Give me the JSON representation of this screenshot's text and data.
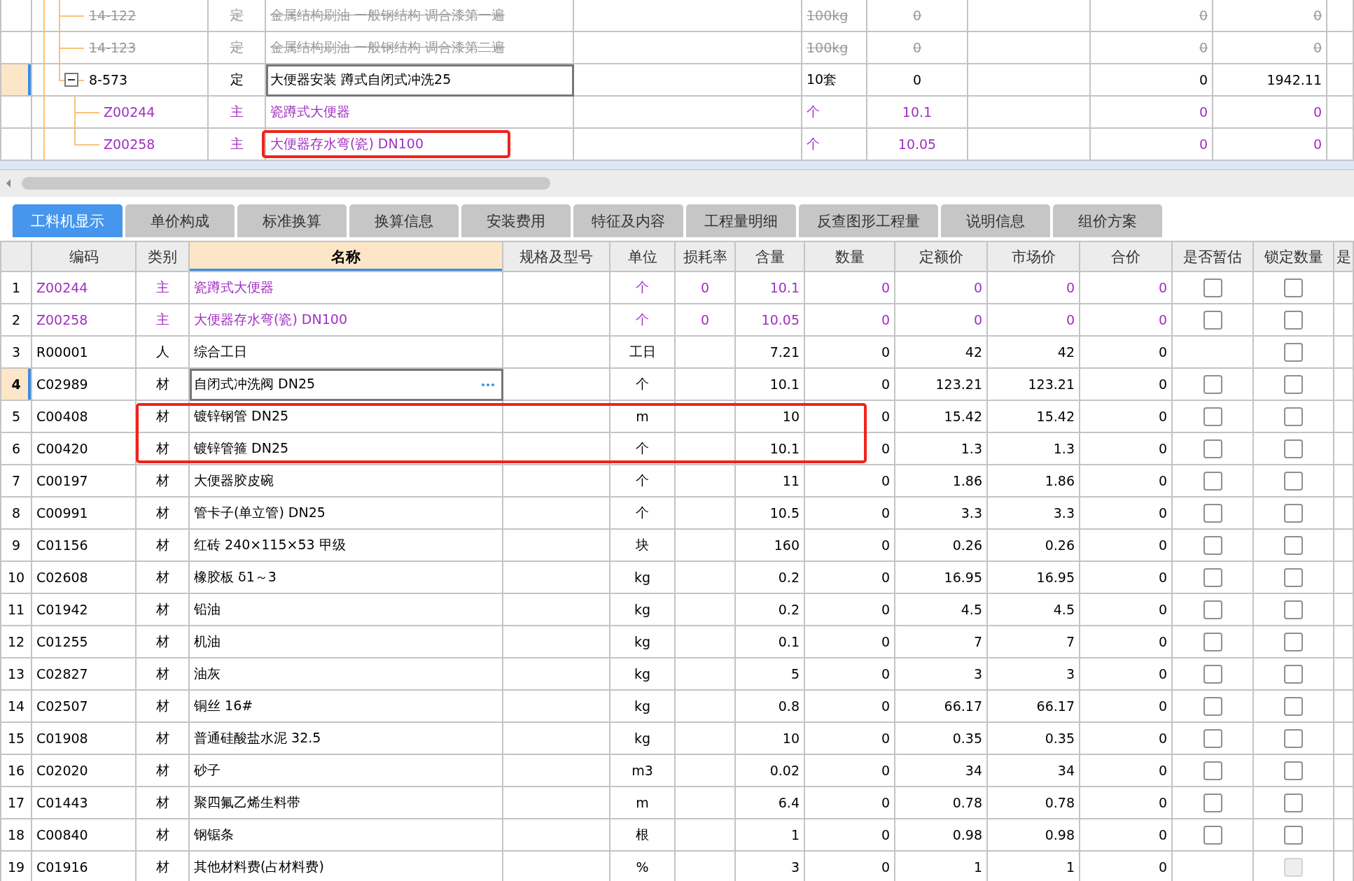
{
  "top": {
    "rows": [
      {
        "code": "14-122",
        "type": "定",
        "name": "金属结构刷油 一般钢结构 调合漆第一遍",
        "unit": "100kg",
        "qty": "0",
        "col_8": "0",
        "col_9": "0",
        "deleted": true,
        "selected": false,
        "color": "#999999"
      },
      {
        "code": "14-123",
        "type": "定",
        "name": "金属结构刷油 一般钢结构 调合漆第二遍",
        "unit": "100kg",
        "qty": "0",
        "col_8": "0",
        "col_9": "0",
        "deleted": true,
        "selected": false,
        "color": "#999999"
      },
      {
        "code": "8-573",
        "type": "定",
        "name": "大便器安装 蹲式自闭式冲洗25",
        "unit": "10套",
        "qty": "0",
        "col_8": "0",
        "col_9": "1942.11",
        "deleted": false,
        "selected": true,
        "expanded": true,
        "color": "#000000",
        "children": [
          {
            "code": "Z00244",
            "type": "主",
            "name": "瓷蹲式大便器",
            "unit": "个",
            "qty": "10.1",
            "col_8": "0",
            "col_9": "0",
            "deleted": false,
            "selected": false,
            "color": "#a030c0"
          },
          {
            "code": "Z00258",
            "type": "主",
            "name": "大便器存水弯(瓷) DN100",
            "unit": "个",
            "qty": "10.05",
            "col_8": "0",
            "col_9": "0",
            "deleted": false,
            "selected": false,
            "marked": true,
            "color": "#a030c0"
          }
        ]
      }
    ]
  },
  "tabs": [
    {
      "label": "工料机显示",
      "selected": true
    },
    {
      "label": "单价构成",
      "selected": false
    },
    {
      "label": "标准换算",
      "selected": false
    },
    {
      "label": "换算信息",
      "selected": false
    },
    {
      "label": "安装费用",
      "selected": false
    },
    {
      "label": "特征及内容",
      "selected": false
    },
    {
      "label": "工程量明细",
      "selected": false
    },
    {
      "label": "反查图形工程量",
      "selected": false
    },
    {
      "label": "说明信息",
      "selected": false
    },
    {
      "label": "组价方案",
      "selected": false
    }
  ],
  "materials": {
    "columns": [
      {
        "label": "编码",
        "selected": false
      },
      {
        "label": "类别",
        "selected": false
      },
      {
        "label": "名称",
        "selected": true
      },
      {
        "label": "规格及型号",
        "selected": false
      },
      {
        "label": "单位",
        "selected": false
      },
      {
        "label": "损耗率",
        "selected": false
      },
      {
        "label": "含量",
        "selected": false
      },
      {
        "label": "数量",
        "selected": false
      },
      {
        "label": "定额价",
        "selected": false
      },
      {
        "label": "市场价",
        "selected": false
      },
      {
        "label": "合价",
        "selected": false
      },
      {
        "label": "是否暂估",
        "selected": false
      },
      {
        "label": "锁定数量",
        "selected": false
      },
      {
        "label": "是",
        "selected": false
      }
    ],
    "rows": [
      {
        "num": "1",
        "code": "Z00244",
        "type": "主",
        "name": "瓷蹲式大便器",
        "unit": "个",
        "loss": "0",
        "content": "10.1",
        "qty": "0",
        "quota": "0",
        "market": "0",
        "total": "0",
        "estimate": {
          "checked": false
        },
        "lock": {
          "checked": false,
          "disabled": false
        },
        "selected": false,
        "marked": false,
        "color": "#a030c0"
      },
      {
        "num": "2",
        "code": "Z00258",
        "type": "主",
        "name": "大便器存水弯(瓷) DN100",
        "unit": "个",
        "loss": "0",
        "content": "10.05",
        "qty": "0",
        "quota": "0",
        "market": "0",
        "total": "0",
        "estimate": {
          "checked": false
        },
        "lock": {
          "checked": false,
          "disabled": false
        },
        "selected": false,
        "marked": false,
        "color": "#a030c0"
      },
      {
        "num": "3",
        "code": "R00001",
        "type": "人",
        "name": "综合工日",
        "unit": "工日",
        "content": "7.21",
        "qty": "0",
        "quota": "42",
        "market": "42",
        "total": "0",
        "lock": {
          "checked": false,
          "disabled": false
        },
        "selected": false,
        "marked": false,
        "color": "#000000"
      },
      {
        "num": "4",
        "code": "C02989",
        "type": "材",
        "name": "自闭式冲洗阀 DN25",
        "unit": "个",
        "content": "10.1",
        "qty": "0",
        "quota": "123.21",
        "market": "123.21",
        "total": "0",
        "estimate": {
          "checked": false
        },
        "lock": {
          "checked": false,
          "disabled": false
        },
        "selected": true,
        "marked": false,
        "color": "#000000"
      },
      {
        "num": "5",
        "code": "C00408",
        "type": "材",
        "name": "镀锌钢管 DN25",
        "unit": "m",
        "content": "10",
        "qty": "0",
        "quota": "15.42",
        "market": "15.42",
        "total": "0",
        "estimate": {
          "checked": false
        },
        "lock": {
          "checked": false,
          "disabled": false
        },
        "selected": false,
        "marked": true,
        "color": "#000000"
      },
      {
        "num": "6",
        "code": "C00420",
        "type": "材",
        "name": "镀锌管箍 DN25",
        "unit": "个",
        "content": "10.1",
        "qty": "0",
        "quota": "1.3",
        "market": "1.3",
        "total": "0",
        "estimate": {
          "checked": false
        },
        "lock": {
          "checked": false,
          "disabled": false
        },
        "selected": false,
        "marked": true,
        "color": "#000000"
      },
      {
        "num": "7",
        "code": "C00197",
        "type": "材",
        "name": "大便器胶皮碗",
        "unit": "个",
        "content": "11",
        "qty": "0",
        "quota": "1.86",
        "market": "1.86",
        "total": "0",
        "estimate": {
          "checked": false
        },
        "lock": {
          "checked": false,
          "disabled": false
        },
        "selected": false,
        "marked": false,
        "color": "#000000"
      },
      {
        "num": "8",
        "code": "C00991",
        "type": "材",
        "name": "管卡子(单立管) DN25",
        "unit": "个",
        "content": "10.5",
        "qty": "0",
        "quota": "3.3",
        "market": "3.3",
        "total": "0",
        "estimate": {
          "checked": false
        },
        "lock": {
          "checked": false,
          "disabled": false
        },
        "selected": false,
        "marked": false,
        "color": "#000000"
      },
      {
        "num": "9",
        "code": "C01156",
        "type": "材",
        "name": "红砖 240×115×53 甲级",
        "unit": "块",
        "content": "160",
        "qty": "0",
        "quota": "0.26",
        "market": "0.26",
        "total": "0",
        "estimate": {
          "checked": false
        },
        "lock": {
          "checked": false,
          "disabled": false
        },
        "selected": false,
        "marked": false,
        "color": "#000000"
      },
      {
        "num": "10",
        "code": "C02608",
        "type": "材",
        "name": "橡胶板 δ1～3",
        "unit": "kg",
        "content": "0.2",
        "qty": "0",
        "quota": "16.95",
        "market": "16.95",
        "total": "0",
        "estimate": {
          "checked": false
        },
        "lock": {
          "checked": false,
          "disabled": false
        },
        "selected": false,
        "marked": false,
        "color": "#000000"
      },
      {
        "num": "11",
        "code": "C01942",
        "type": "材",
        "name": "铅油",
        "unit": "kg",
        "content": "0.2",
        "qty": "0",
        "quota": "4.5",
        "market": "4.5",
        "total": "0",
        "estimate": {
          "checked": false
        },
        "lock": {
          "checked": false,
          "disabled": false
        },
        "selected": false,
        "marked": false,
        "color": "#000000"
      },
      {
        "num": "12",
        "code": "C01255",
        "type": "材",
        "name": "机油",
        "unit": "kg",
        "content": "0.1",
        "qty": "0",
        "quota": "7",
        "market": "7",
        "total": "0",
        "estimate": {
          "checked": false
        },
        "lock": {
          "checked": false,
          "disabled": false
        },
        "selected": false,
        "marked": false,
        "color": "#000000"
      },
      {
        "num": "13",
        "code": "C02827",
        "type": "材",
        "name": "油灰",
        "unit": "kg",
        "content": "5",
        "qty": "0",
        "quota": "3",
        "market": "3",
        "total": "0",
        "estimate": {
          "checked": false
        },
        "lock": {
          "checked": false,
          "disabled": false
        },
        "selected": false,
        "marked": false,
        "color": "#000000"
      },
      {
        "num": "14",
        "code": "C02507",
        "type": "材",
        "name": "铜丝 16#",
        "unit": "kg",
        "content": "0.8",
        "qty": "0",
        "quota": "66.17",
        "market": "66.17",
        "total": "0",
        "estimate": {
          "checked": false
        },
        "lock": {
          "checked": false,
          "disabled": false
        },
        "selected": false,
        "marked": false,
        "color": "#000000"
      },
      {
        "num": "15",
        "code": "C01908",
        "type": "材",
        "name": "普通硅酸盐水泥 32.5",
        "unit": "kg",
        "content": "10",
        "qty": "0",
        "quota": "0.35",
        "market": "0.35",
        "total": "0",
        "estimate": {
          "checked": false
        },
        "lock": {
          "checked": false,
          "disabled": false
        },
        "selected": false,
        "marked": false,
        "color": "#000000"
      },
      {
        "num": "16",
        "code": "C02020",
        "type": "材",
        "name": "砂子",
        "unit": "m3",
        "content": "0.02",
        "qty": "0",
        "quota": "34",
        "market": "34",
        "total": "0",
        "estimate": {
          "checked": false
        },
        "lock": {
          "checked": false,
          "disabled": false
        },
        "selected": false,
        "marked": false,
        "color": "#000000"
      },
      {
        "num": "17",
        "code": "C01443",
        "type": "材",
        "name": "聚四氟乙烯生料带",
        "unit": "m",
        "content": "6.4",
        "qty": "0",
        "quota": "0.78",
        "market": "0.78",
        "total": "0",
        "estimate": {
          "checked": false
        },
        "lock": {
          "checked": false,
          "disabled": false
        },
        "selected": false,
        "marked": false,
        "color": "#000000"
      },
      {
        "num": "18",
        "code": "C00840",
        "type": "材",
        "name": "钢锯条",
        "unit": "根",
        "content": "1",
        "qty": "0",
        "quota": "0.98",
        "market": "0.98",
        "total": "0",
        "estimate": {
          "checked": false
        },
        "lock": {
          "checked": false,
          "disabled": false
        },
        "selected": false,
        "marked": false,
        "color": "#000000"
      },
      {
        "num": "19",
        "code": "C01916",
        "type": "材",
        "name": "其他材料费(占材料费)",
        "unit": "%",
        "content": "3",
        "qty": "0",
        "quota": "1",
        "market": "1",
        "total": "0",
        "lock": {
          "checked": false,
          "disabled": true
        },
        "selected": false,
        "marked": false,
        "color": "#000000"
      }
    ]
  }
}
